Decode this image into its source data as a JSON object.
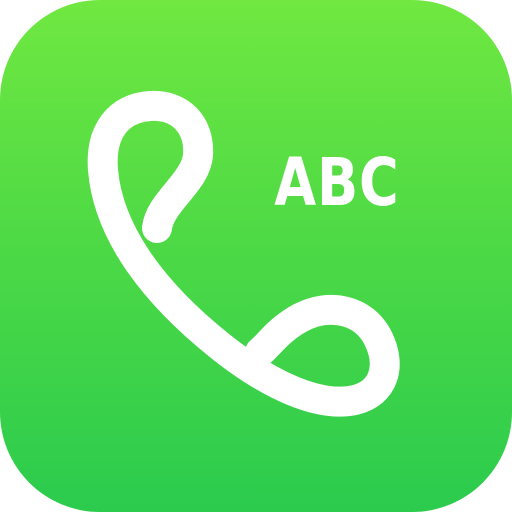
{
  "icon": {
    "label": "ABC",
    "glyph": "phone-handset-icon",
    "colors": {
      "gradient_top": "#70E841",
      "gradient_bottom": "#2BCB4E",
      "foreground": "#FFFFFF"
    }
  }
}
